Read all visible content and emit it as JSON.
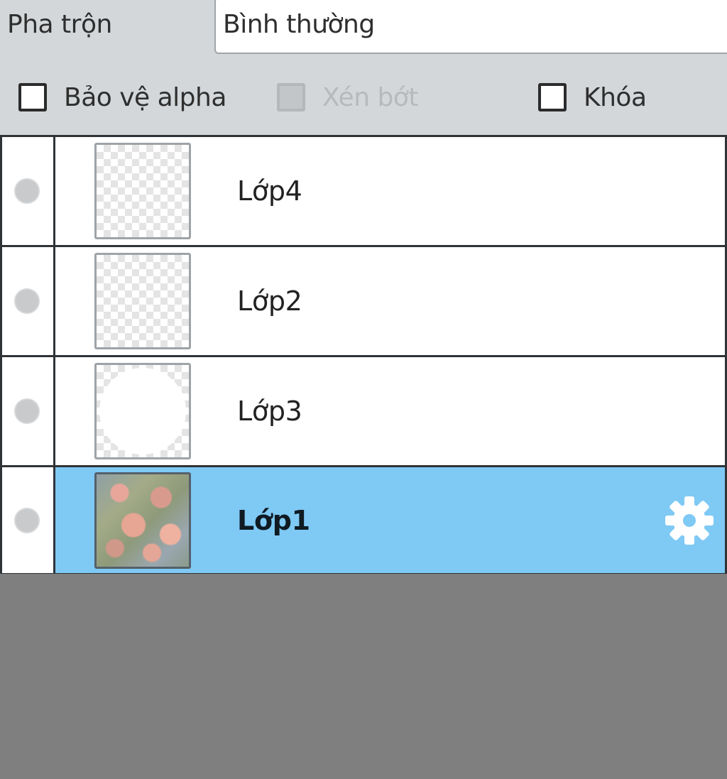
{
  "blend": {
    "label": "Pha trộn",
    "value": "Bình thường"
  },
  "options": {
    "protect_alpha": {
      "label": "Bảo vệ alpha",
      "checked": false,
      "enabled": true
    },
    "clip": {
      "label": "Xén bớt",
      "checked": false,
      "enabled": false
    },
    "lock": {
      "label": "Khóa",
      "checked": false,
      "enabled": true
    }
  },
  "layers": [
    {
      "name": "Lớp4",
      "thumbnail": "transparent",
      "selected": false
    },
    {
      "name": "Lớp2",
      "thumbnail": "transparent",
      "selected": false
    },
    {
      "name": "Lớp3",
      "thumbnail": "white-circle",
      "selected": false
    },
    {
      "name": "Lớp1",
      "thumbnail": "flower-photo",
      "selected": true
    }
  ],
  "colors": {
    "selected_row": "#7fc9f5",
    "panel_bg": "#d3d7da",
    "empty_area": "#7f7f7f"
  },
  "icons": {
    "settings": "gear-icon",
    "visibility": "visibility-dot-icon"
  }
}
